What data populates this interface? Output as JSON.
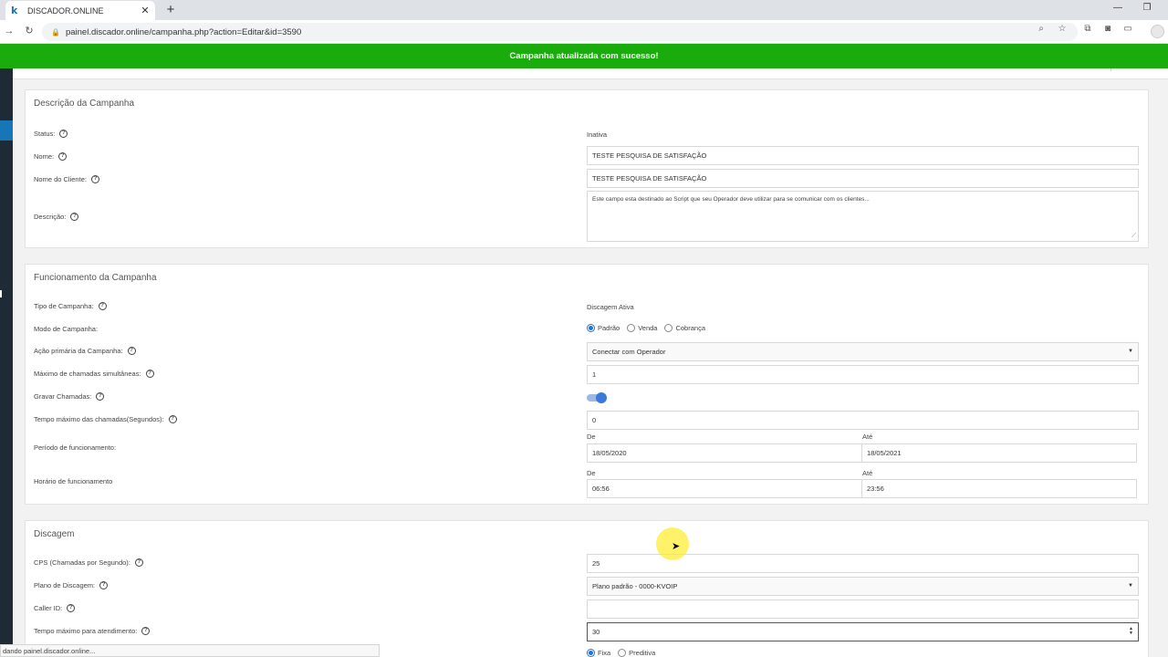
{
  "browser": {
    "tab_title": "DISCADOR.ONLINE",
    "tab_favicon": "k",
    "url": "painel.discador.online/campanha.php?action=Editar&id=3590",
    "status_text": "dando painel.discador.online..."
  },
  "banner": {
    "message": "Campanha atualizada com sucesso!",
    "color": "#1aab0c"
  },
  "descricao": {
    "title": "Descrição da Campanha",
    "status_label": "Status:",
    "status_value": "Inativa",
    "nome_label": "Nome:",
    "nome_value": "TESTE PESQUISA DE SATISFAÇÃO",
    "cliente_label": "Nome do Cliente:",
    "cliente_value": "TESTE PESQUISA DE SATISFAÇÃO",
    "descricao_label": "Descrição:",
    "descricao_value": "Este campo esta destinado ao Script que seu Operador deve utilizar para se comunicar com os clientes..."
  },
  "funcionamento": {
    "title": "Funcionamento da Campanha",
    "tipo_label": "Tipo de Campanha:",
    "tipo_value": "Discagem Ativa",
    "modo_label": "Modo de Campanha:",
    "modo_options": [
      "Padrão",
      "Venda",
      "Cobrança"
    ],
    "modo_selected": "Padrão",
    "acao_label": "Ação primária da Campanha:",
    "acao_value": "Conectar com Operador",
    "max_label": "Máximo de chamadas simultâneas:",
    "max_value": "1",
    "gravar_label": "Gravar Chamadas:",
    "gravar_on": true,
    "tempo_label": "Tempo máximo das chamadas(Segundos):",
    "tempo_value": "0",
    "periodo_label": "Período de funcionamento:",
    "periodo_de_label": "De",
    "periodo_de": "18/05/2020",
    "periodo_ate_label": "Até",
    "periodo_ate": "18/05/2021",
    "horario_label": "Horário de funcionamento",
    "horario_de_label": "De",
    "horario_de": "06:56",
    "horario_ate_label": "Até",
    "horario_ate": "23:56"
  },
  "discagem": {
    "title": "Discagem",
    "cps_label": "CPS (Chamadas por Segundo):",
    "cps_value": "25",
    "plano_label": "Plano de Discagem:",
    "plano_value": "Plano padrão - 0000-KVOIP",
    "callerid_label": "Caller ID:",
    "callerid_value": "",
    "atendimento_label": "Tempo máximo para atendimento:",
    "atendimento_value": "30",
    "tipo_options": [
      "Fixa",
      "Preditiva"
    ],
    "tipo_selected": "Fixa"
  }
}
